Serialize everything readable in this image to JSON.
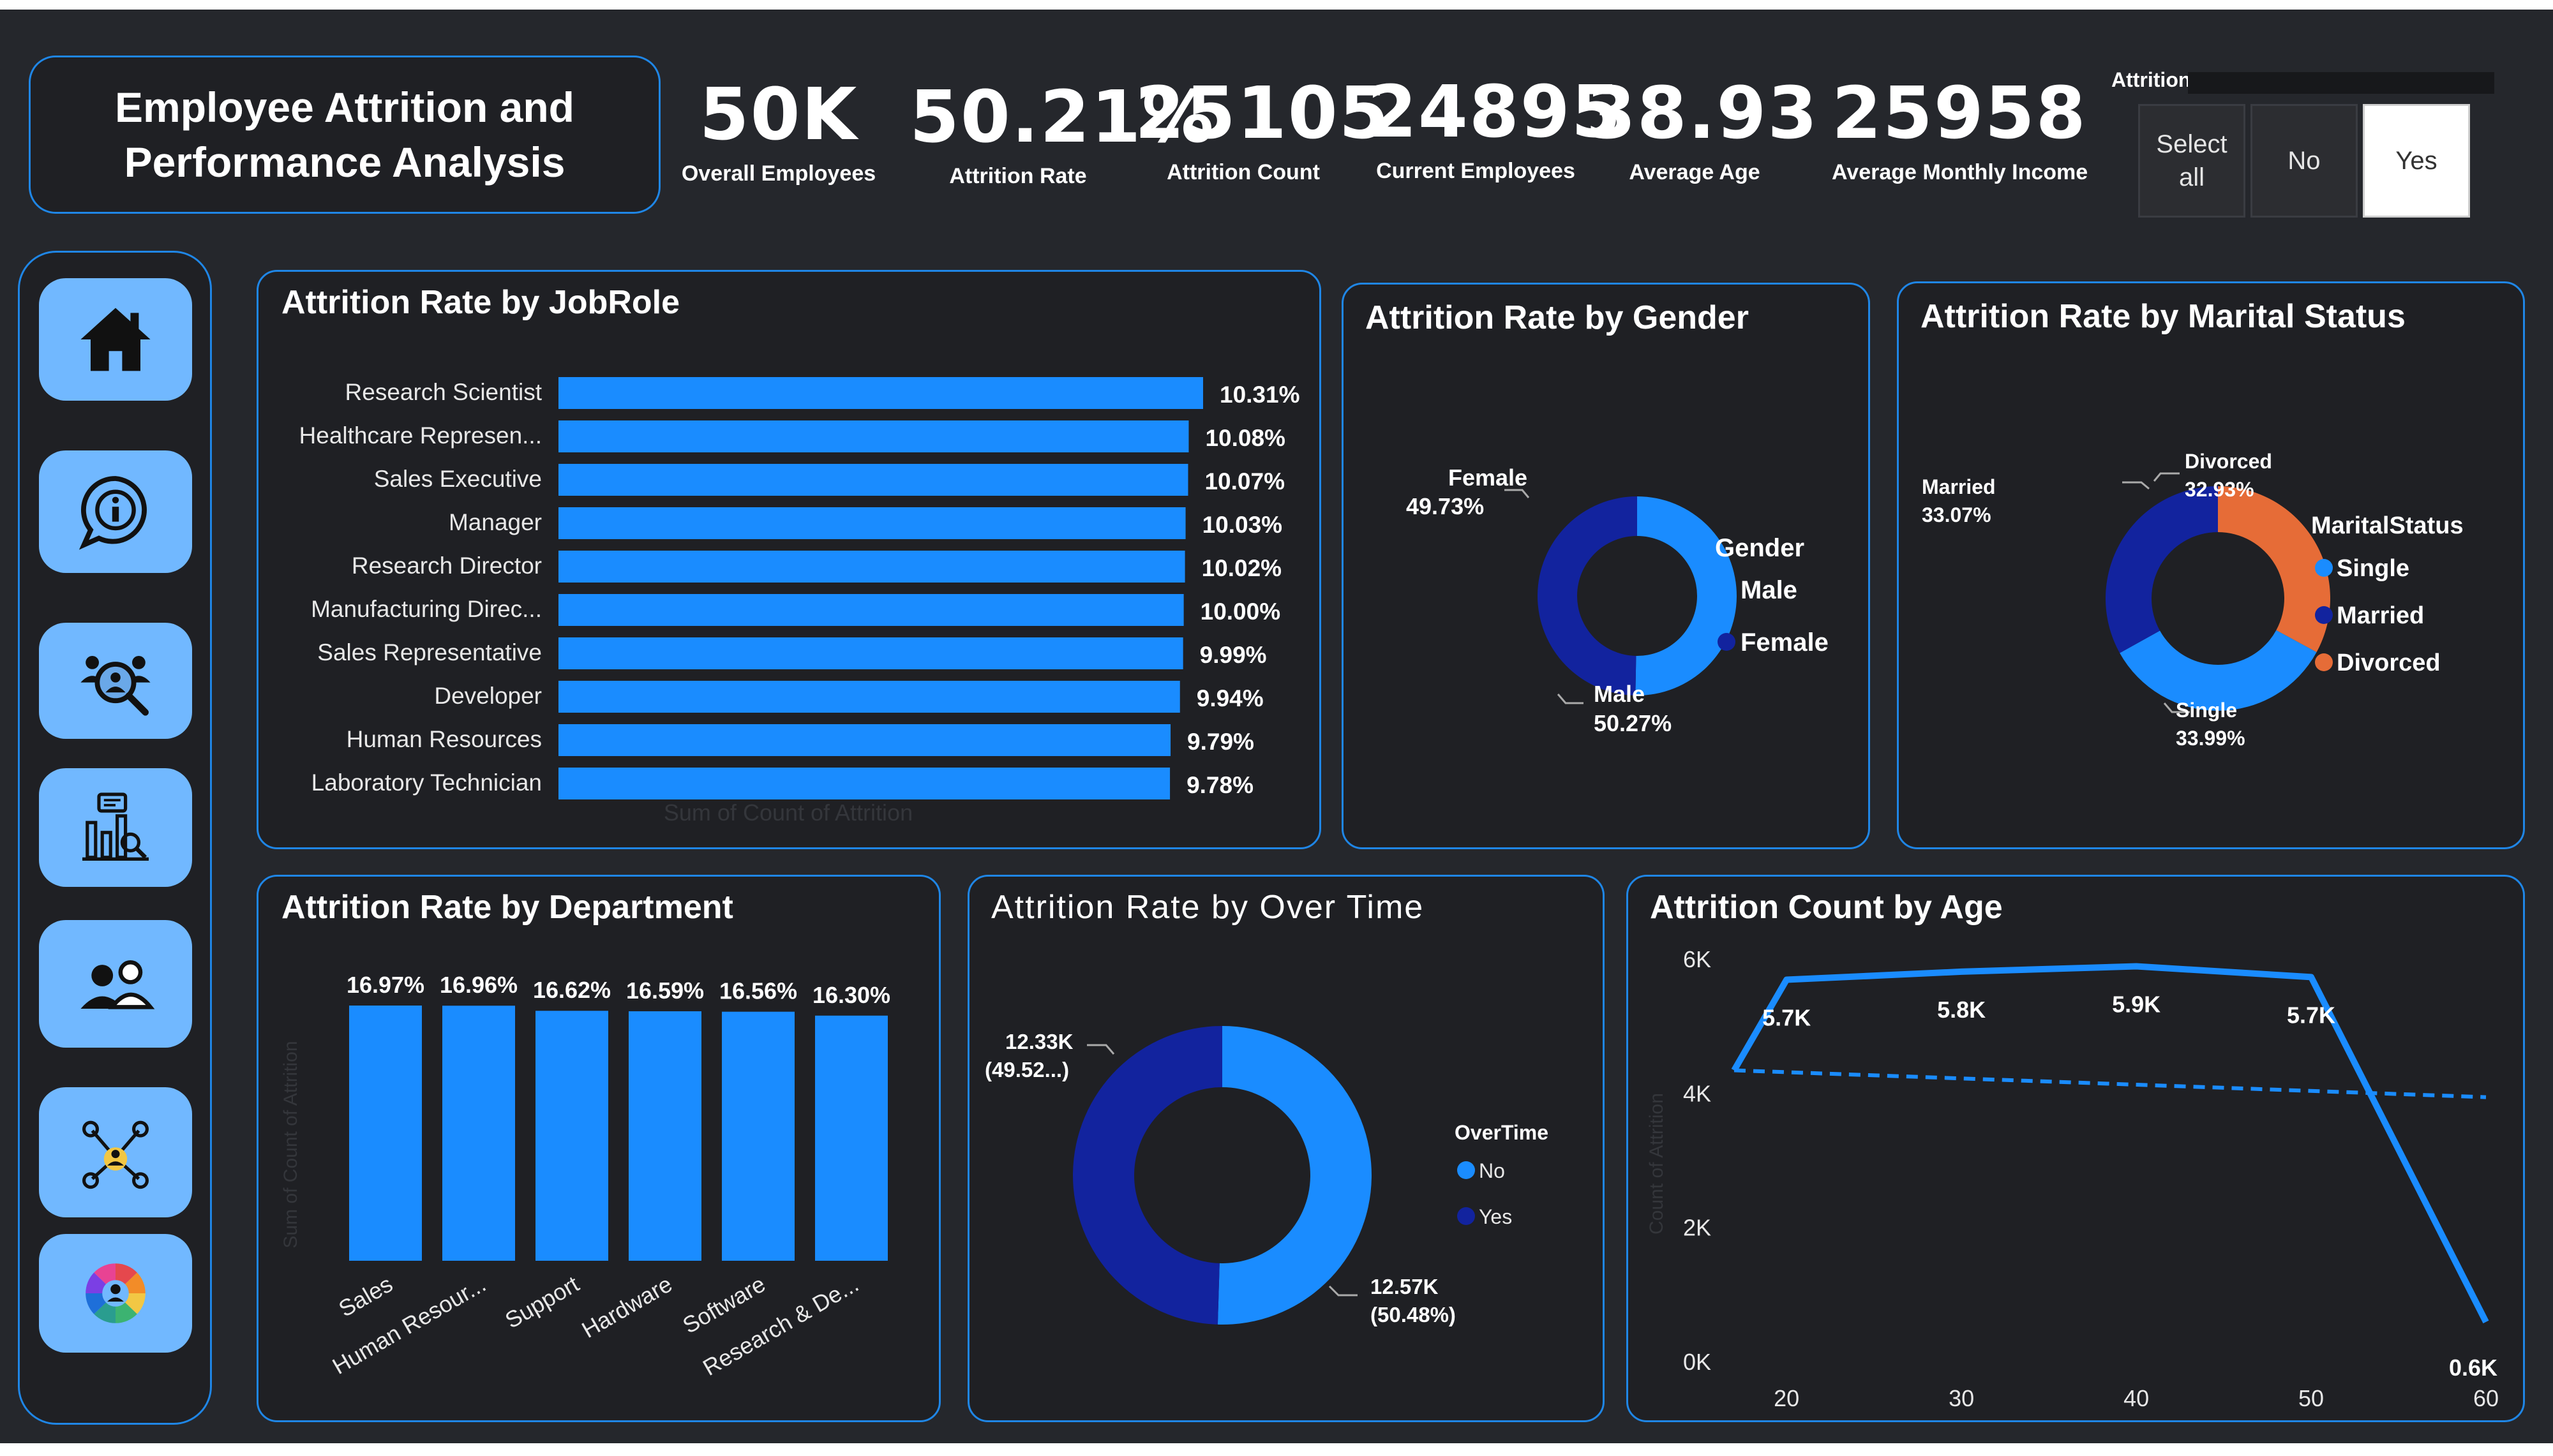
{
  "header": {
    "title_line1": "Employee Attrition and",
    "title_line2": "Performance Analysis"
  },
  "kpis": [
    {
      "value": "50K",
      "label": "Overall Employees"
    },
    {
      "value": "50.21%",
      "label": "Attrition Rate"
    },
    {
      "value": "25105",
      "label": "Attrition Count"
    },
    {
      "value": "24895",
      "label": "Current Employees"
    },
    {
      "value": "38.93",
      "label": "Average Age"
    },
    {
      "value": "25958",
      "label": "Average Monthly Income"
    }
  ],
  "slicer": {
    "title": "Attrition",
    "options": [
      {
        "label_line1": "Select",
        "label_line2": "all",
        "selected": false
      },
      {
        "label_line1": "No",
        "label_line2": "",
        "selected": false
      },
      {
        "label_line1": "Yes",
        "label_line2": "",
        "selected": true
      }
    ]
  },
  "nav": [
    {
      "icon": "home-icon"
    },
    {
      "icon": "info-icon"
    },
    {
      "icon": "people-search-icon"
    },
    {
      "icon": "report-analytics-icon"
    },
    {
      "icon": "employees-icon"
    },
    {
      "icon": "network-icon"
    },
    {
      "icon": "team-wheel-icon"
    }
  ],
  "colors": {
    "primary": "#1a8cff",
    "dark_blue": "#12239e",
    "orange": "#e66c37",
    "panel_border": "#1f86e6",
    "background": "#25272c"
  },
  "chart_data": [
    {
      "id": "jobrole",
      "type": "bar",
      "orientation": "horizontal",
      "title": "Attrition Rate by JobRole",
      "xlabel": "Sum of Count of Attrition",
      "categories": [
        "Research Scientist",
        "Healthcare Represen...",
        "Sales Executive",
        "Manager",
        "Research Director",
        "Manufacturing Direc...",
        "Sales Representative",
        "Developer",
        "Human Resources",
        "Laboratory Technician"
      ],
      "values": [
        10.31,
        10.08,
        10.07,
        10.03,
        10.02,
        10.0,
        9.99,
        9.94,
        9.79,
        9.78
      ],
      "labels": [
        "10.31%",
        "10.08%",
        "10.07%",
        "10.03%",
        "10.02%",
        "10.00%",
        "9.99%",
        "9.94%",
        "9.79%",
        "9.78%"
      ],
      "xlim": [
        0,
        10.31
      ]
    },
    {
      "id": "gender",
      "type": "pie",
      "title": "Attrition Rate by Gender",
      "legend_title": "Gender",
      "legend_position": "right",
      "slices": [
        {
          "name": "Male",
          "value": 50.27,
          "label": "50.27%",
          "color": "#1a8cff"
        },
        {
          "name": "Female",
          "value": 49.73,
          "label": "49.73%",
          "color": "#12239e"
        }
      ]
    },
    {
      "id": "marital",
      "type": "pie",
      "title": "Attrition Rate by Marital Status",
      "legend_title": "MaritalStatus",
      "legend_position": "right",
      "slices": [
        {
          "name": "Single",
          "value": 33.99,
          "label": "33.99%",
          "color": "#1a8cff"
        },
        {
          "name": "Married",
          "value": 33.07,
          "label": "33.07%",
          "color": "#12239e"
        },
        {
          "name": "Divorced",
          "value": 32.93,
          "label": "32.93%",
          "color": "#e66c37"
        }
      ]
    },
    {
      "id": "department",
      "type": "bar",
      "title": "Attrition Rate by Department",
      "ylabel": "Sum of Count of Attrition",
      "categories": [
        "Sales",
        "Human Resour...",
        "Support",
        "Hardware",
        "Software",
        "Research & De..."
      ],
      "values": [
        16.97,
        16.96,
        16.62,
        16.59,
        16.56,
        16.3
      ],
      "labels": [
        "16.97%",
        "16.96%",
        "16.62%",
        "16.59%",
        "16.56%",
        "16.30%"
      ],
      "ylim": [
        0,
        16.97
      ]
    },
    {
      "id": "overtime",
      "type": "pie",
      "title": "Attrition Rate by Over Time",
      "legend_title": "OverTime",
      "legend_position": "right",
      "slices": [
        {
          "name": "No",
          "value": 50.48,
          "label_line1": "12.57K",
          "label_line2": "(50.48%)",
          "color": "#1a8cff"
        },
        {
          "name": "Yes",
          "value": 49.52,
          "label_line1": "12.33K",
          "label_line2": "(49.52...)",
          "color": "#12239e"
        }
      ]
    },
    {
      "id": "age",
      "type": "line",
      "title": "Attrition Count by Age",
      "ylabel": "Count of Attrition",
      "xticks": [
        "20",
        "30",
        "40",
        "50",
        "60"
      ],
      "yticks": [
        "0K",
        "2K",
        "4K",
        "6K"
      ],
      "xlim": [
        17,
        60
      ],
      "ylim": [
        0,
        6000
      ],
      "x": [
        17,
        20,
        30,
        40,
        50,
        60
      ],
      "y": [
        4350,
        5700,
        5820,
        5900,
        5740,
        600
      ],
      "trend": [
        4350,
        3950
      ],
      "point_labels": [
        {
          "x": 20,
          "label": "5.7K"
        },
        {
          "x": 30,
          "label": "5.8K"
        },
        {
          "x": 40,
          "label": "5.9K"
        },
        {
          "x": 50,
          "label": "5.7K"
        },
        {
          "x": 60,
          "label": "0.6K"
        }
      ]
    }
  ]
}
